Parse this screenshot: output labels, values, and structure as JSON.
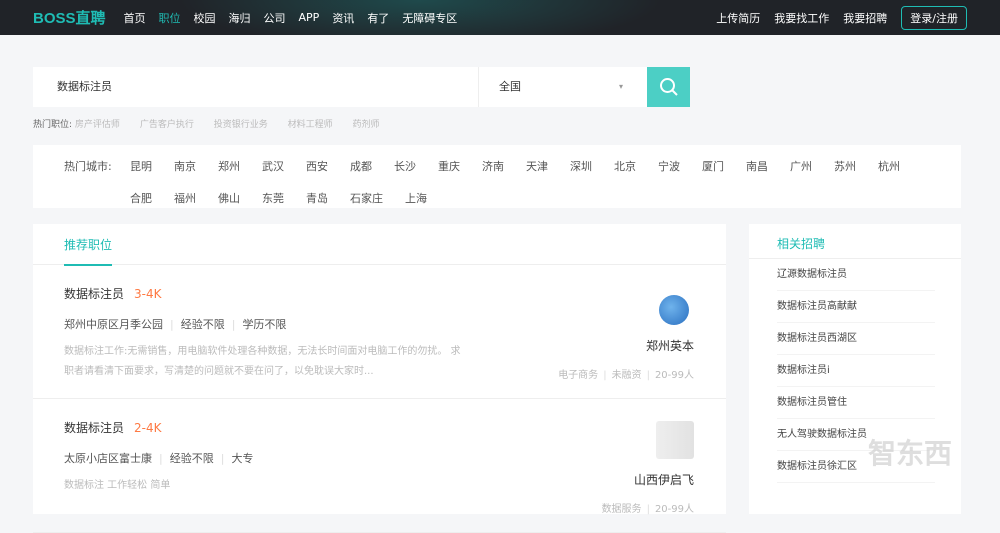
{
  "nav": {
    "logo": "BOSS直聘",
    "items": [
      "首页",
      "职位",
      "校园",
      "海归",
      "公司",
      "APP",
      "资讯",
      "有了",
      "无障碍专区"
    ],
    "active": 1,
    "right": [
      "上传简历",
      "我要找工作",
      "我要招聘"
    ],
    "login": "登录/注册"
  },
  "search": {
    "query": "数据标注员",
    "city": "全国",
    "arrow": "▾"
  },
  "hot_jobs": {
    "label": "热门职位:",
    "items": [
      "房产评估师",
      "广告客户执行",
      "投资银行业务",
      "材料工程师",
      "药剂师"
    ]
  },
  "hot_cities": {
    "label": "热门城市:",
    "items": [
      "昆明",
      "南京",
      "郑州",
      "武汉",
      "西安",
      "成都",
      "长沙",
      "重庆",
      "济南",
      "天津",
      "深圳",
      "北京",
      "宁波",
      "厦门",
      "南昌",
      "广州",
      "苏州",
      "杭州",
      "合肥",
      "福州",
      "佛山",
      "东莞",
      "青岛",
      "石家庄",
      "上海"
    ]
  },
  "main": {
    "tab": "推荐职位",
    "jobs": [
      {
        "title": "数据标注员",
        "salary": "3-4K",
        "location": "郑州中原区月季公园",
        "experience": "经验不限",
        "education": "学历不限",
        "desc": "数据标注工作:无需销售，用电脑软件处理各种数据，无法长时间面对电脑工作的勿扰。 求职者请看清下面要求，写清楚的问题就不要在问了，以免耽误大家时...",
        "company": "郑州英本",
        "industry": "电子商务",
        "funding": "未融资",
        "size": "20-99人"
      },
      {
        "title": "数据标注员",
        "salary": "2-4K",
        "location": "太原小店区富士康",
        "experience": "经验不限",
        "education": "大专",
        "desc": "数据标注 工作轻松 简单",
        "company": "山西伊启飞",
        "industry": "数据服务",
        "size": "20-99人"
      }
    ]
  },
  "side": {
    "title": "相关招聘",
    "items": [
      "辽源数据标注员",
      "数据标注员高献献",
      "数据标注员西湖区",
      "数据标注员i",
      "数据标注员管住",
      "无人驾驶数据标注员",
      "数据标注员徐汇区"
    ]
  },
  "watermark": "智东西"
}
